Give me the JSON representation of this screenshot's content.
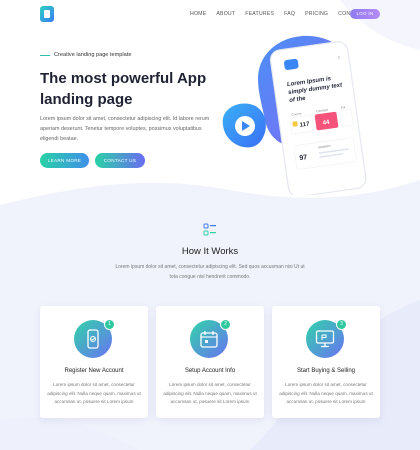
{
  "header": {
    "nav": [
      "HOME",
      "ABOUT",
      "FEATURES",
      "FAQ",
      "PRICING",
      "CONTACT"
    ],
    "login_label": "LOG IN"
  },
  "hero": {
    "tagline": "Creative landing page template",
    "title": "The most powerful App landing page",
    "description": "Lorem ipsum dolor sit amet, consectetur adipiscing elit. Id labore rerum aperiam deserunt. Tenetur tempore voluptes, possimus voluptatibus eligendi beatae.",
    "learn_more_label": "LEARN MORE",
    "contact_label": "CONTACT US"
  },
  "phone": {
    "heading": "Lorem Ipsum is simply dummy text of the",
    "stat_1_label": "Course",
    "stat_1_value": "117",
    "stat_2_label": "Contract",
    "stat_2_value": "44",
    "stat_3_label": "Fnl",
    "stat_4_value": "97",
    "stat_4_label": "Statistics"
  },
  "how_it_works": {
    "title": "How It Works",
    "description": "Lorem ipsum dolor sit amet, consectetur adipiscing elit. Sed quos accusman nisi Ut ut tota congue nisl hendrerit commodo."
  },
  "steps": [
    {
      "number": "1",
      "title": "Register New Account",
      "icon": "phone-register-icon",
      "description": "Lorem ipsum dolor sit amet, consectetur adipiscing elit. Nulla neque quam, maximus ut accumsan ut, posuere sit Lorem ipsum"
    },
    {
      "number": "2",
      "title": "Setup Account Info",
      "icon": "calendar-icon",
      "description": "Lorem ipsum dolor sit amet, consectetur adipiscing elit. Nulla neque quam, maximus ut accumsan ut, posuere sit Lorem ipsum"
    },
    {
      "number": "3",
      "title": "Start Buying & Selling",
      "icon": "monitor-icon",
      "description": "Lorem ipsum dolor sit amet, consectetur adipiscing elit. Nulla neque quam, maximus ut accumsan ut, posuere sit Lorem ipsum"
    }
  ],
  "colors": {
    "accent_teal": "#2ad1a6",
    "accent_purple": "#8f7bf2",
    "accent_blue": "#3b7cf5",
    "stat_yellow": "#f5c842",
    "stat_pink": "#f5537a"
  }
}
